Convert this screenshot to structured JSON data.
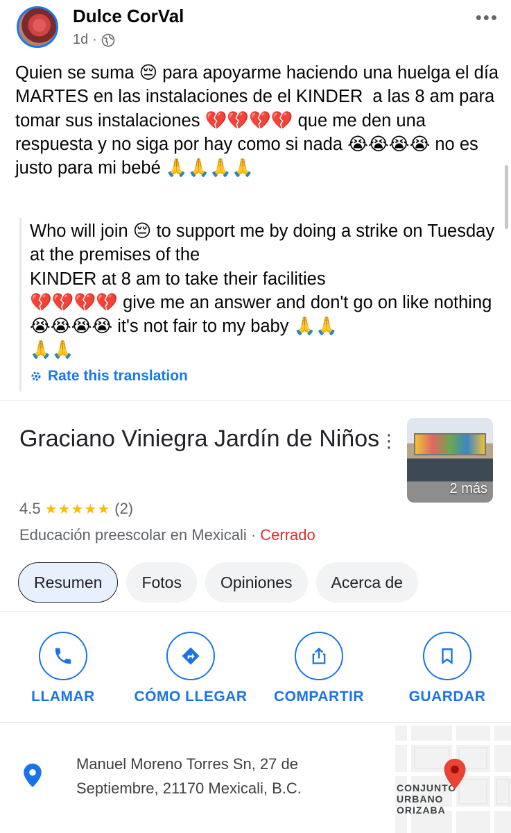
{
  "post": {
    "author": "Dulce CorVal",
    "time": "1d",
    "body": "Quien se suma 😔 para apoyarme haciendo una huelga el día MARTES en las instalaciones de el KINDER  a las 8 am para tomar sus instalaciones 💔💔💔💔 que me den una respuesta y no siga por hay como si nada 😭😭😭😭 no es justo para mi bebé 🙏🙏🙏🙏",
    "translation": "Who will join 😔 to support me by doing a strike on Tuesday at the premises of the\nKINDER at 8 am to take their facilities\n💔💔💔💔 give me an answer and don't go on like nothing 😭😭😭😭 it's not fair to my baby 🙏🙏\n🙏🙏",
    "rate_translation": "Rate this translation"
  },
  "place": {
    "title": "Graciano Viniegra Jardín de Niños",
    "photo_more": "2 más",
    "rating": "4.5",
    "stars": "★★★★★",
    "review_count": "(2)",
    "category": "Educación preescolar en Mexicali · ",
    "status": "Cerrado",
    "status_color": "#d93025",
    "tabs": [
      "Resumen",
      "Fotos",
      "Opiniones",
      "Acerca de"
    ],
    "actions": [
      {
        "label": "LLAMAR",
        "icon": "phone-icon"
      },
      {
        "label": "CÓMO LLEGAR",
        "icon": "directions-icon"
      },
      {
        "label": "COMPARTIR",
        "icon": "share-icon"
      },
      {
        "label": "GUARDAR",
        "icon": "bookmark-icon"
      }
    ],
    "address": "Manuel Moreno Torres Sn, 27 de Septiembre, 21170 Mexicali, B.C.",
    "map_label": "CONJUNTO\nURBANO\nORIZABA",
    "accent_color": "#1a73e8"
  }
}
